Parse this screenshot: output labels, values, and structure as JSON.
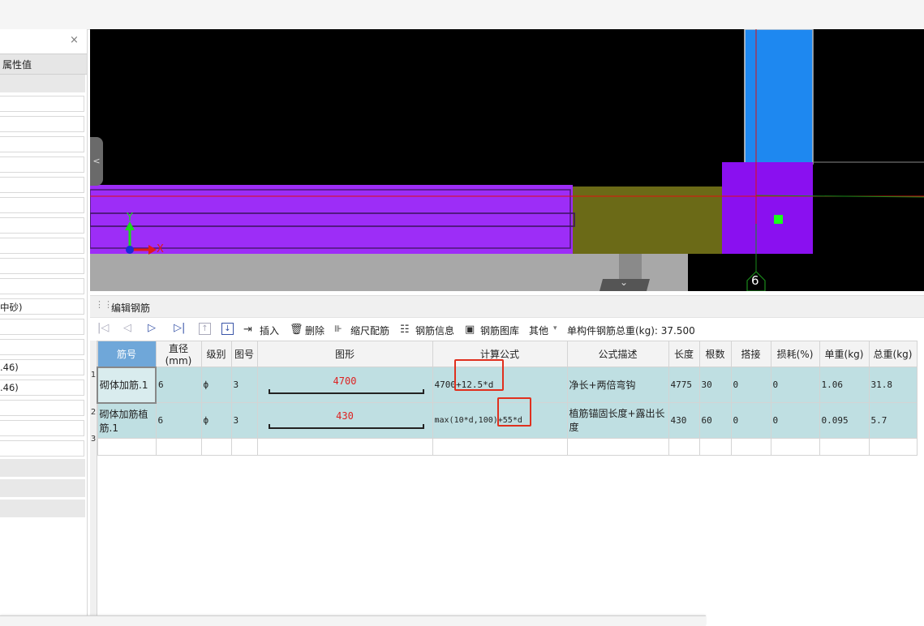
{
  "left_panel": {
    "close_label": "×",
    "header": "属性值",
    "rows": [
      "",
      "",
      "",
      "",
      "",
      "",
      "",
      "",
      "",
      "",
      "中砂)",
      "",
      "",
      ".46)",
      ".46)",
      "",
      "",
      ""
    ]
  },
  "canvas": {
    "axis_y": "Y",
    "axis_x": "X",
    "axis_marker": "6",
    "collapse_arrow": "<",
    "down_arrow": "⌄"
  },
  "edit_bar": {
    "title": "编辑钢筋",
    "grip": "⋮⋮"
  },
  "toolbar": {
    "first": "|◁",
    "prev": "◁",
    "next": "▷",
    "last": "▷|",
    "up": "↑",
    "down": "↓",
    "insert": "插入",
    "delete": "删除",
    "scale": "缩尺配筋",
    "info": "钢筋信息",
    "library": "钢筋图库",
    "other": "其他",
    "other_arrow": "▾",
    "total_label": "单构件钢筋总重(kg): 37.500"
  },
  "table": {
    "headers": [
      "筋号",
      "直径(mm)",
      "级别",
      "图号",
      "图形",
      "计算公式",
      "公式描述",
      "长度",
      "根数",
      "搭接",
      "损耗(%)",
      "单重(kg)",
      "总重(kg)"
    ],
    "rows": [
      {
        "num": "1",
        "name": "砌体加筋.1",
        "dia": "6",
        "grade": "ф",
        "fig": "3",
        "shape_len": "4700",
        "formula": "4700+12.5*d",
        "desc": "净长+两倍弯钩",
        "length": "4775",
        "count": "30",
        "lap": "0",
        "loss": "0",
        "unit": "1.06",
        "total": "31.8"
      },
      {
        "num": "2",
        "name": "砌体加筋植筋.1",
        "dia": "6",
        "grade": "ф",
        "fig": "3",
        "shape_len": "430",
        "formula": "max(10*d,100)+55*d",
        "desc": "植筋锚固长度+露出长度",
        "length": "430",
        "count": "60",
        "lap": "0",
        "loss": "0",
        "unit": "0.095",
        "total": "5.7"
      }
    ],
    "empty_row_num": "3"
  },
  "colors": {
    "beam": "#9d2df7",
    "olive": "#6b6a17",
    "column": "#1e88f0",
    "row_bg": "#bfdfe2",
    "highlight": "#e0301e"
  }
}
